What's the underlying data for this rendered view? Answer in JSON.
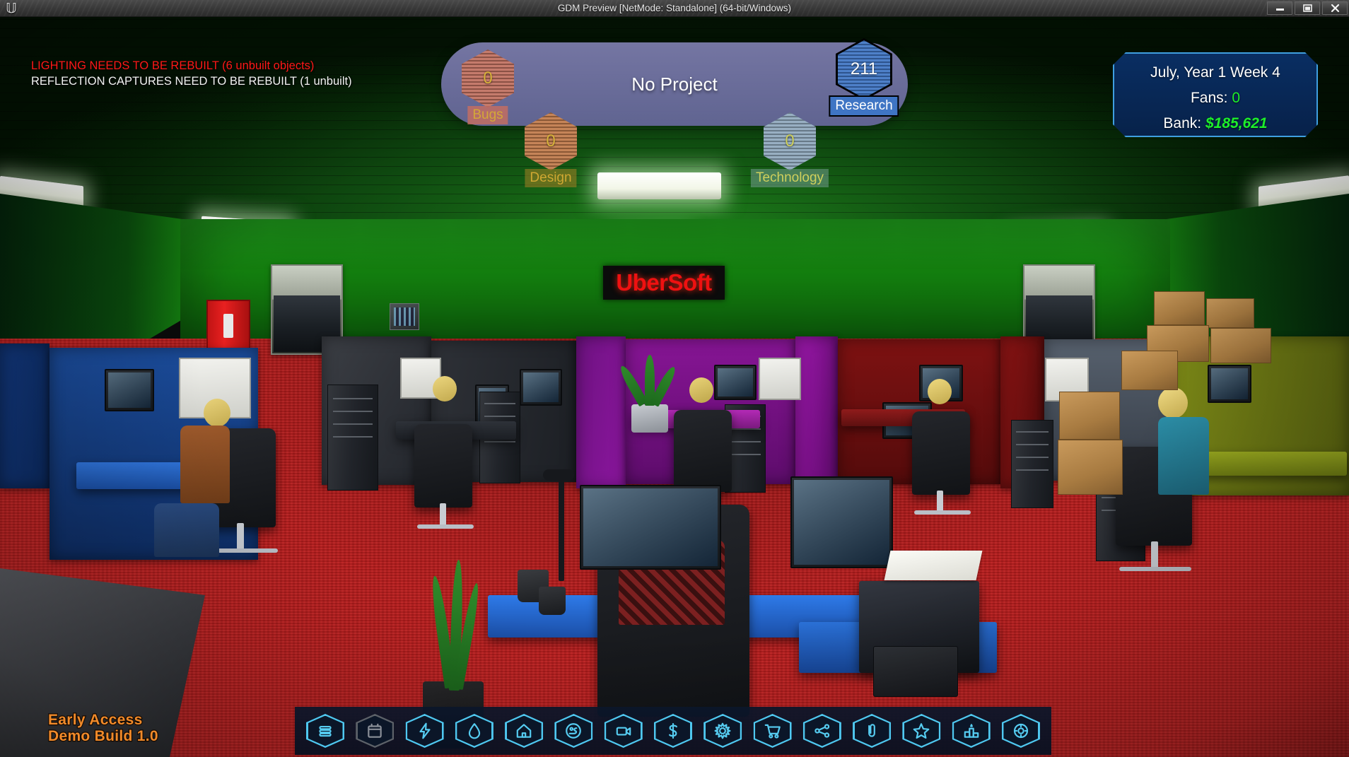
{
  "window": {
    "title": "GDM Preview [NetMode: Standalone] (64-bit/Windows)",
    "logo_icon": "unreal-engine-logo",
    "controls": [
      {
        "name": "minimize",
        "icon": "minimize-icon"
      },
      {
        "name": "maximize",
        "icon": "maximize-icon"
      },
      {
        "name": "close",
        "icon": "close-icon"
      }
    ]
  },
  "engine_warnings": {
    "lighting": "LIGHTING NEEDS TO BE REBUILT (6 unbuilt objects)",
    "reflection": "REFLECTION CAPTURES NEED TO BE REBUILT (1 unbuilt)",
    "lighting_color": "#ff1818",
    "reflection_color": "#f2f2f2"
  },
  "project_hud": {
    "title": "No Project",
    "stats": [
      {
        "key": "bugs",
        "label": "Bugs",
        "value": "0",
        "color": "#c07060"
      },
      {
        "key": "design",
        "label": "Design",
        "value": "0",
        "color": "#c07a4a"
      },
      {
        "key": "technology",
        "label": "Technology",
        "value": "0",
        "color": "#8fa8bd"
      },
      {
        "key": "research",
        "label": "Research",
        "value": "211",
        "color": "#3f75c4",
        "selected": true
      }
    ]
  },
  "info_panel": {
    "date": "July, Year 1 Week 4",
    "fans_label": "Fans:",
    "fans_value": "0",
    "bank_label": "Bank:",
    "bank_value": "$185,621",
    "accent_border": "#3f9fe0",
    "money_color": "#1dee2a"
  },
  "scene": {
    "company_sign": "UberSoft",
    "sign_color": "#ee1111"
  },
  "toolbar": {
    "accent": "#56cdf2",
    "items": [
      {
        "name": "tasks-list-button",
        "icon": "list-icon",
        "enabled": true
      },
      {
        "name": "calendar-button",
        "icon": "calendar-icon",
        "enabled": false
      },
      {
        "name": "energy-button",
        "icon": "lightning-icon",
        "enabled": true
      },
      {
        "name": "water-button",
        "icon": "droplet-icon",
        "enabled": true
      },
      {
        "name": "office-button",
        "icon": "home-icon",
        "enabled": true
      },
      {
        "name": "staff-button",
        "icon": "person-icon",
        "enabled": true
      },
      {
        "name": "marketing-button",
        "icon": "video-camera-icon",
        "enabled": true
      },
      {
        "name": "finance-button",
        "icon": "dollar-icon",
        "enabled": true
      },
      {
        "name": "research-button",
        "icon": "gear-sun-icon",
        "enabled": true
      },
      {
        "name": "shop-button",
        "icon": "cart-icon",
        "enabled": true
      },
      {
        "name": "network-button",
        "icon": "share-icon",
        "enabled": true
      },
      {
        "name": "contracts-button",
        "icon": "paperclip-icon",
        "enabled": true
      },
      {
        "name": "reviews-button",
        "icon": "star-icon",
        "enabled": true
      },
      {
        "name": "awards-button",
        "icon": "podium-icon",
        "enabled": true
      },
      {
        "name": "settings-button",
        "icon": "settings-icon",
        "enabled": true
      }
    ]
  },
  "build_tag": {
    "line1": "Early Access",
    "line2": "Demo Build 1.0",
    "color": "#f08a2a"
  }
}
